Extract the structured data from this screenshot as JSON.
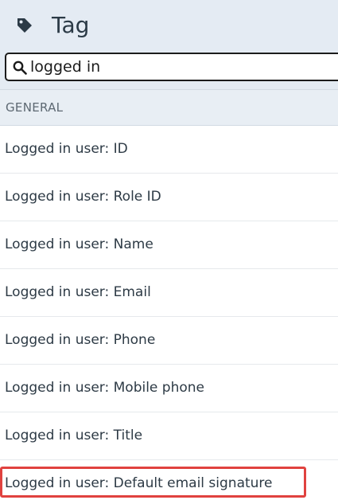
{
  "header": {
    "title": "Tag",
    "icon": "tag-icon"
  },
  "search": {
    "value": "logged in",
    "icon": "search-icon"
  },
  "section": {
    "label": "GENERAL"
  },
  "items": [
    {
      "label": "Logged in user: ID"
    },
    {
      "label": "Logged in user: Role ID"
    },
    {
      "label": "Logged in user: Name"
    },
    {
      "label": "Logged in user: Email"
    },
    {
      "label": "Logged in user: Phone"
    },
    {
      "label": "Logged in user: Mobile phone"
    },
    {
      "label": "Logged in user: Title"
    },
    {
      "label": "Logged in user: Default email signature"
    }
  ],
  "colors": {
    "header_bg": "#e4ebf3",
    "highlight": "#e0423f"
  }
}
